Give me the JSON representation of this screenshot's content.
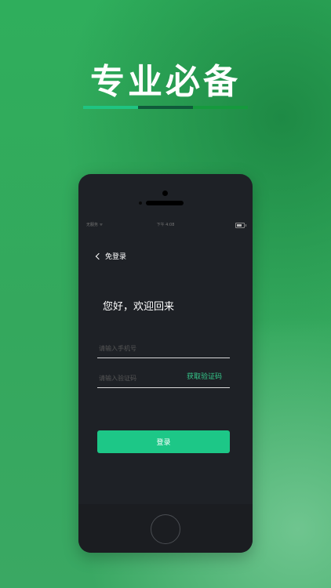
{
  "headline": "专业必备",
  "colors": {
    "background": "#34a85d",
    "accent": "#1dc787",
    "divider": [
      "#1fc482",
      "#0f5a3a",
      "#159a3d"
    ]
  },
  "phone": {
    "statusbar": {
      "carrier": "无服务 ᯤ",
      "time": "下午 4:08"
    },
    "nav": {
      "back_icon": "chevron-left-icon",
      "back_label": "免登录"
    },
    "greeting": "您好，欢迎回来",
    "phone_input": {
      "placeholder": "请输入手机号"
    },
    "code_input": {
      "placeholder": "请输入验证码"
    },
    "get_code_label": "获取验证码",
    "login_label": "登录"
  }
}
